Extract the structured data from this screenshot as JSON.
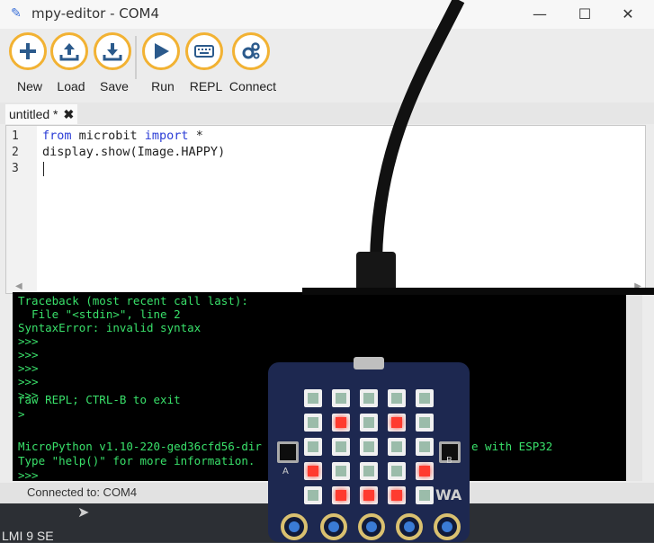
{
  "window": {
    "title": "mpy-editor - COM4",
    "title_icon": "pen-icon",
    "controls": {
      "minimize": "—",
      "maximize": "☐",
      "close": "✕"
    }
  },
  "toolbar": {
    "buttons": [
      {
        "label": "New",
        "icon": "plus-icon"
      },
      {
        "label": "Load",
        "icon": "upload-icon"
      },
      {
        "label": "Save",
        "icon": "download-icon"
      },
      {
        "label": "Run",
        "icon": "play-icon"
      },
      {
        "label": "REPL",
        "icon": "keyboard-icon"
      },
      {
        "label": "Connect",
        "icon": "gears-icon"
      }
    ],
    "accent": "#f2b233"
  },
  "tabs": [
    {
      "label": "untitled *",
      "close": "✖"
    }
  ],
  "editor": {
    "lines": [
      {
        "num": "1",
        "parts": [
          {
            "t": "from",
            "kw": true
          },
          {
            "t": " microbit ",
            "kw": false
          },
          {
            "t": "import",
            "kw": true
          },
          {
            "t": " *",
            "kw": false
          }
        ]
      },
      {
        "num": "2",
        "parts": [
          {
            "t": "display.show(Image.HAPPY)",
            "kw": false
          }
        ]
      },
      {
        "num": "3",
        "parts": [
          {
            "t": "",
            "kw": false
          }
        ]
      }
    ],
    "keyword_color": "#2b3dd6"
  },
  "repl": {
    "lines": [
      "Traceback (most recent call last):",
      "  File \"<stdin>\", line 2",
      "SyntaxError: invalid syntax",
      ">>>",
      ">>>",
      ">>>",
      ">>>",
      ">>>",
      "raw REPL; CTRL-B to exit",
      ">",
      "",
      "",
      "MicroPython v1.10-220-ged36cfd56-dir",
      "Type \"help()\" for more information.",
      ">>>"
    ],
    "occluded_tail": "e with ESP32",
    "text_color": "#39e06a"
  },
  "status": {
    "text": "Connected to: COM4"
  },
  "desktop": {
    "label": "LMI 9 SE"
  },
  "device": {
    "button_a": "A",
    "button_b": "B",
    "logo": "WA",
    "led_matrix": [
      [
        0,
        0,
        0,
        0,
        0
      ],
      [
        0,
        1,
        0,
        1,
        0
      ],
      [
        0,
        0,
        0,
        0,
        0
      ],
      [
        1,
        0,
        0,
        0,
        1
      ],
      [
        0,
        1,
        1,
        1,
        0
      ]
    ]
  }
}
